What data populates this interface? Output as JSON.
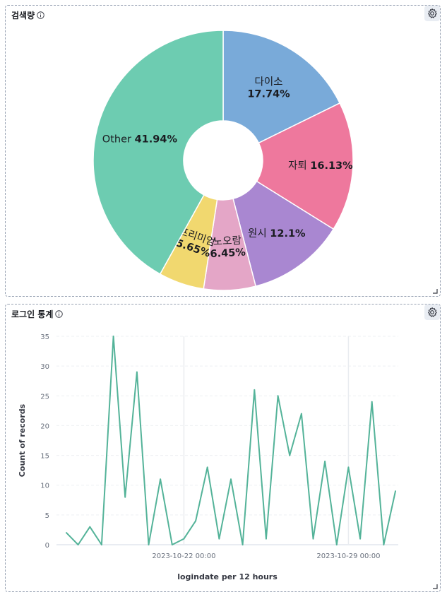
{
  "panels": {
    "pie": {
      "title": "검색량"
    },
    "line": {
      "title": "로그인 통계"
    }
  },
  "icons": {
    "info": "info-icon",
    "gear": "gear-icon",
    "resize": "resize-handle-icon"
  },
  "colors": {
    "pie": [
      "#79aad9",
      "#ee789d",
      "#a987d1",
      "#e4a6c7",
      "#f1d86f",
      "#6dccb1"
    ],
    "line": "#54b399"
  },
  "chart_data": [
    {
      "type": "pie",
      "donut": true,
      "slices": [
        {
          "label": "다이소",
          "value": 17.74,
          "pct": "17.74%"
        },
        {
          "label": "자퇴",
          "value": 16.13,
          "pct": "16.13%"
        },
        {
          "label": "원시",
          "value": 12.1,
          "pct": "12.1%"
        },
        {
          "label": "노오람",
          "value": 6.45,
          "pct": "6.45%"
        },
        {
          "label": "프리미엄",
          "value": 5.65,
          "pct": "5.65%"
        },
        {
          "label": "Other",
          "value": 41.94,
          "pct": "41.94%"
        }
      ]
    },
    {
      "type": "line",
      "xlabel": "logindate per 12 hours",
      "ylabel": "Count of records",
      "ylim": [
        0,
        35
      ],
      "yticks": [
        0,
        5,
        10,
        15,
        20,
        25,
        30,
        35
      ],
      "x_tick_labels": [
        {
          "at_index": 10,
          "label": "2023-10-22 00:00"
        },
        {
          "at_index": 24,
          "label": "2023-10-29 00:00"
        }
      ],
      "grid": true,
      "values": [
        2,
        0,
        3,
        0,
        35,
        8,
        29,
        0,
        11,
        0,
        1,
        4,
        13,
        1,
        11,
        0,
        26,
        1,
        25,
        15,
        22,
        1,
        14,
        0,
        13,
        1,
        24,
        0,
        9
      ]
    }
  ]
}
